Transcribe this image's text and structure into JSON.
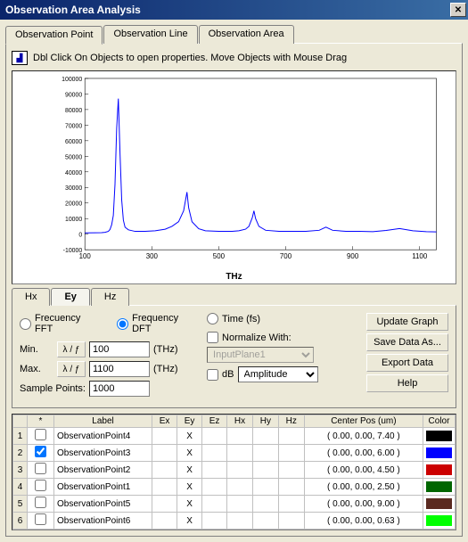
{
  "window": {
    "title": "Observation Area Analysis"
  },
  "tabs": [
    "Observation Point",
    "Observation Line",
    "Observation Area"
  ],
  "info_text": "Dbl Click On Objects to open properties. Move Objects with Mouse Drag",
  "chart": {
    "xlabel": "THz"
  },
  "component_tabs": [
    "Hx",
    "Ey",
    "Hz"
  ],
  "controls": {
    "freq_fft": "Frecuency FFT",
    "freq_dft": "Frequency DFT",
    "time_fs": "Time (fs)",
    "min": "Min.",
    "max": "Max.",
    "sample_points": "Sample Points:",
    "unit_btn": "λ / ƒ",
    "min_val": "100",
    "max_val": "1100",
    "sample_val": "1000",
    "thz": "(THz)",
    "normalize": "Normalize With:",
    "input_select": "InputPlane1",
    "db": "dB",
    "amp_select": "Amplitude",
    "update": "Update Graph",
    "save": "Save Data As...",
    "export": "Export Data",
    "help": "Help"
  },
  "table": {
    "headers": [
      "",
      "*",
      "Label",
      "Ex",
      "Ey",
      "Ez",
      "Hx",
      "Hy",
      "Hz",
      "Center Pos (um)",
      "Color"
    ],
    "rows": [
      {
        "n": "1",
        "chk": false,
        "label": "ObservationPoint4",
        "ey": "X",
        "pos": "( 0.00, 0.00, 7.40 )",
        "color": "#000000"
      },
      {
        "n": "2",
        "chk": true,
        "label": "ObservationPoint3",
        "ey": "X",
        "pos": "( 0.00, 0.00, 6.00 )",
        "color": "#0000ff"
      },
      {
        "n": "3",
        "chk": false,
        "label": "ObservationPoint2",
        "ey": "X",
        "pos": "( 0.00, 0.00, 4.50 )",
        "color": "#cc0000"
      },
      {
        "n": "4",
        "chk": false,
        "label": "ObservationPoint1",
        "ey": "X",
        "pos": "( 0.00, 0.00, 2.50 )",
        "color": "#006600"
      },
      {
        "n": "5",
        "chk": false,
        "label": "ObservationPoint5",
        "ey": "X",
        "pos": "( 0.00, 0.00, 9.00 )",
        "color": "#5a2a20"
      },
      {
        "n": "6",
        "chk": false,
        "label": "ObservationPoint6",
        "ey": "X",
        "pos": "( 0.00, 0.00, 0.63 )",
        "color": "#00ff00"
      }
    ]
  },
  "chart_data": {
    "type": "line",
    "title": "",
    "xlabel": "THz",
    "ylabel": "",
    "xlim": [
      100,
      1150
    ],
    "ylim": [
      -10000,
      100000
    ],
    "yticks": [
      -10000,
      0,
      10000,
      20000,
      30000,
      40000,
      50000,
      60000,
      70000,
      80000,
      90000,
      100000
    ],
    "xticks": [
      100,
      300,
      500,
      700,
      900,
      1100
    ],
    "series": [
      {
        "name": "ObservationPoint3",
        "color": "#0000ff",
        "x": [
          100,
          130,
          150,
          160,
          170,
          175,
          180,
          185,
          190,
          195,
          200,
          205,
          210,
          215,
          220,
          230,
          250,
          280,
          310,
          340,
          360,
          380,
          395,
          405,
          410,
          420,
          440,
          460,
          500,
          540,
          560,
          580,
          590,
          600,
          605,
          610,
          620,
          640,
          680,
          720,
          760,
          800,
          820,
          840,
          880,
          920,
          960,
          1000,
          1040,
          1080,
          1120,
          1150
        ],
        "y": [
          800,
          900,
          1000,
          1200,
          1800,
          3000,
          6000,
          12000,
          32000,
          68000,
          87000,
          52000,
          22000,
          9000,
          4500,
          2800,
          1800,
          1800,
          2200,
          3200,
          5000,
          8000,
          15000,
          27000,
          17000,
          8000,
          3500,
          2200,
          1800,
          1800,
          2200,
          3200,
          5000,
          10500,
          15000,
          10000,
          5000,
          2500,
          1800,
          1800,
          1800,
          2500,
          4500,
          2500,
          1800,
          1800,
          1600,
          2400,
          3600,
          2200,
          1600,
          1500
        ]
      }
    ]
  }
}
